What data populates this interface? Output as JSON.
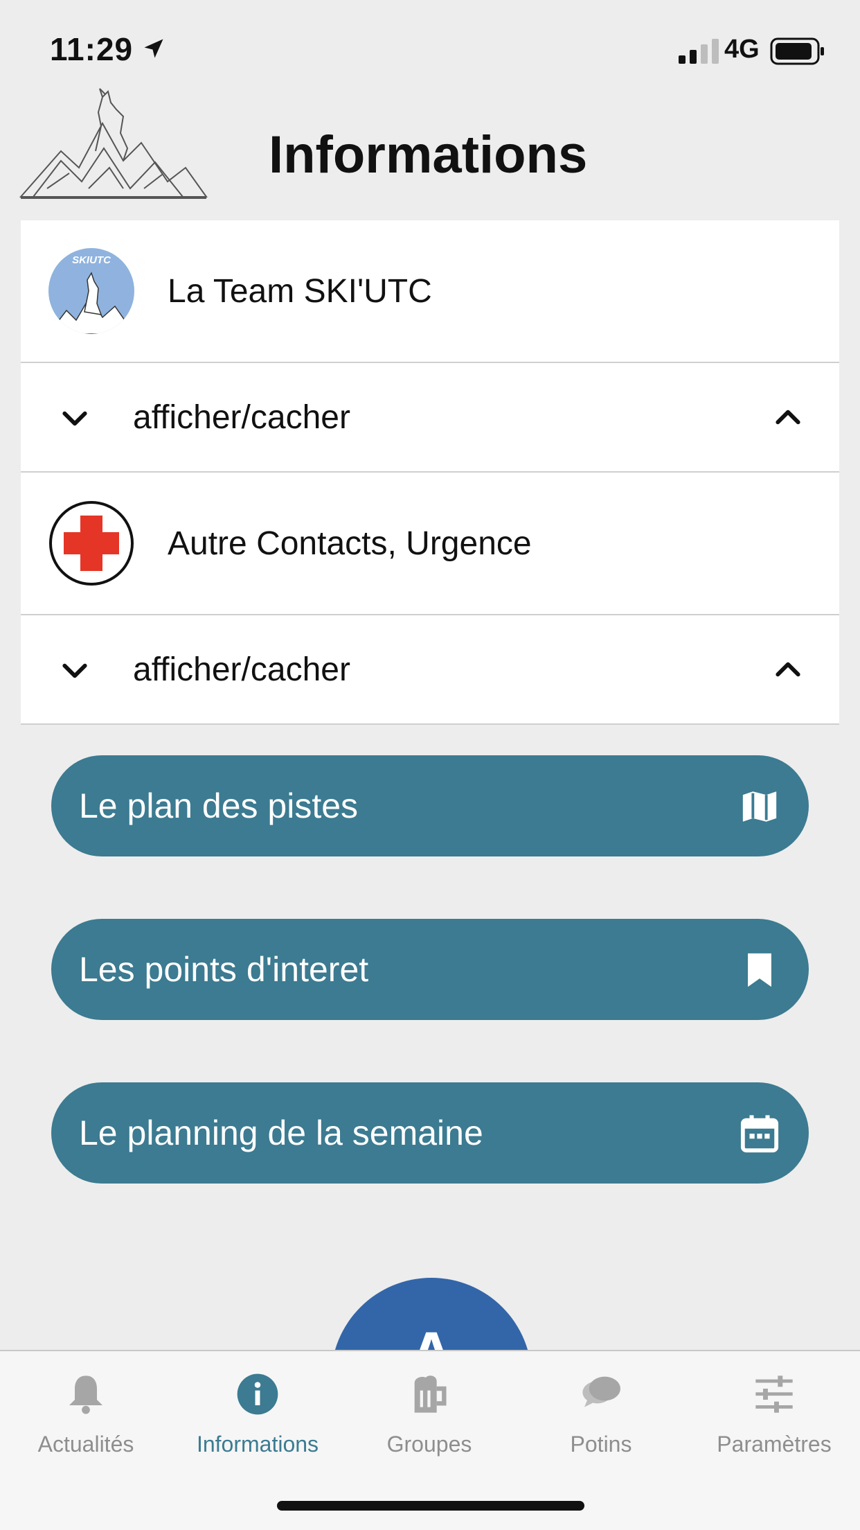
{
  "status_bar": {
    "time": "11:29",
    "network": "4G"
  },
  "header": {
    "title": "Informations"
  },
  "list": {
    "team_contact": {
      "label": "La Team SKI'UTC",
      "avatar_text": "SKIUTC"
    },
    "team_toggle": {
      "label": "afficher/cacher"
    },
    "emergency_contact": {
      "label": "Autre Contacts, Urgence"
    },
    "emergency_toggle": {
      "label": "afficher/cacher"
    }
  },
  "actions": [
    {
      "label": "Le plan des pistes",
      "icon": "map-icon"
    },
    {
      "label": "Les points d'interet",
      "icon": "bookmark-icon"
    },
    {
      "label": "Le planning de la semaine",
      "icon": "calendar-icon"
    }
  ],
  "floating_button": {
    "letter": "A"
  },
  "tabs": [
    {
      "label": "Actualités",
      "icon": "bell-icon",
      "active": false
    },
    {
      "label": "Informations",
      "icon": "info-icon",
      "active": true
    },
    {
      "label": "Groupes",
      "icon": "beer-mug-icon",
      "active": false
    },
    {
      "label": "Potins",
      "icon": "chat-bubbles-icon",
      "active": false
    },
    {
      "label": "Paramètres",
      "icon": "sliders-icon",
      "active": false
    }
  ],
  "colors": {
    "accent": "#3c7b91",
    "background": "#ededed",
    "floating_button": "#3366a8",
    "emergency_red": "#e53526",
    "inactive_tab": "#8e8e8e"
  }
}
